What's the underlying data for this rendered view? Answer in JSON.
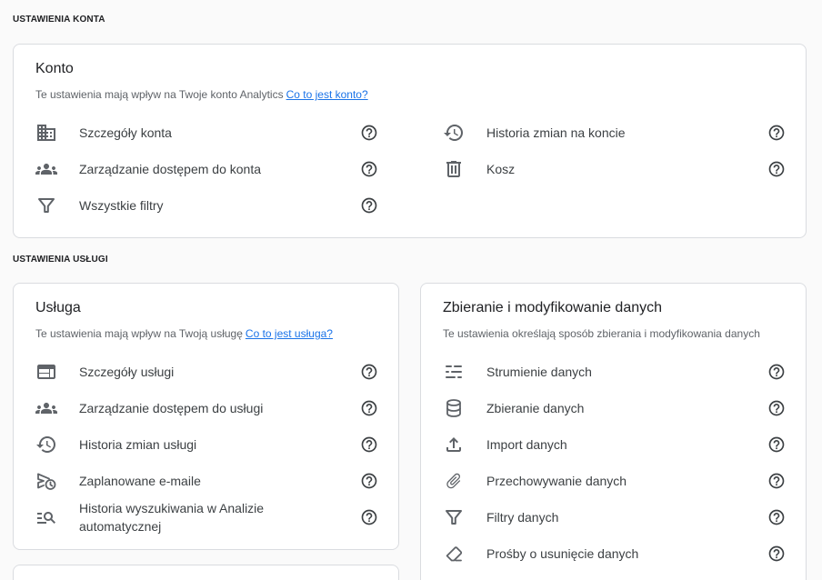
{
  "account_settings": {
    "heading": "USTAWIENIA KONTA",
    "account_card": {
      "title": "Konto",
      "description": "Te ustawienia mają wpływ na Twoje konto Analytics",
      "help_link": "Co to jest konto?",
      "left_items": [
        {
          "label": "Szczegóły konta",
          "icon": "building-icon"
        },
        {
          "label": "Zarządzanie dostępem do konta",
          "icon": "group-icon"
        },
        {
          "label": "Wszystkie filtry",
          "icon": "filter-icon"
        }
      ],
      "right_items": [
        {
          "label": "Historia zmian na koncie",
          "icon": "history-icon"
        },
        {
          "label": "Kosz",
          "icon": "trash-icon"
        }
      ]
    }
  },
  "property_settings": {
    "heading": "USTAWIENIA USŁUGI",
    "property_card": {
      "title": "Usługa",
      "description": "Te ustawienia mają wpływ na Twoją usługę",
      "help_link": "Co to jest usługa?",
      "items": [
        {
          "label": "Szczegóły usługi",
          "icon": "web-icon"
        },
        {
          "label": "Zarządzanie dostępem do usługi",
          "icon": "group-icon"
        },
        {
          "label": "Historia zmian usługi",
          "icon": "history-icon"
        },
        {
          "label": "Zaplanowane e-maile",
          "icon": "scheduled-send-icon"
        },
        {
          "label": "Historia wyszukiwania w Analizie automatycznej",
          "icon": "manage-search-icon"
        }
      ]
    },
    "data_card": {
      "title": "Zbieranie i modyfikowanie danych",
      "description": "Te ustawienia określają sposób zbierania i modyfikowania danych",
      "items": [
        {
          "label": "Strumienie danych",
          "icon": "data-streams-icon"
        },
        {
          "label": "Zbieranie danych",
          "icon": "database-icon"
        },
        {
          "label": "Import danych",
          "icon": "upload-icon"
        },
        {
          "label": "Przechowywanie danych",
          "icon": "paperclip-icon"
        },
        {
          "label": "Filtry danych",
          "icon": "filter-icon"
        },
        {
          "label": "Prośby o usunięcie danych",
          "icon": "eraser-icon"
        }
      ]
    }
  },
  "row_help_icon": "help-icon",
  "colors": {
    "page_background": "#fafafa",
    "card_background": "#ffffff",
    "card_border": "#dadce0",
    "title_text": "#202124",
    "body_text": "#3c4043",
    "secondary_text": "#5f6368",
    "icon": "#5f6368",
    "link": "#1a73e8"
  }
}
